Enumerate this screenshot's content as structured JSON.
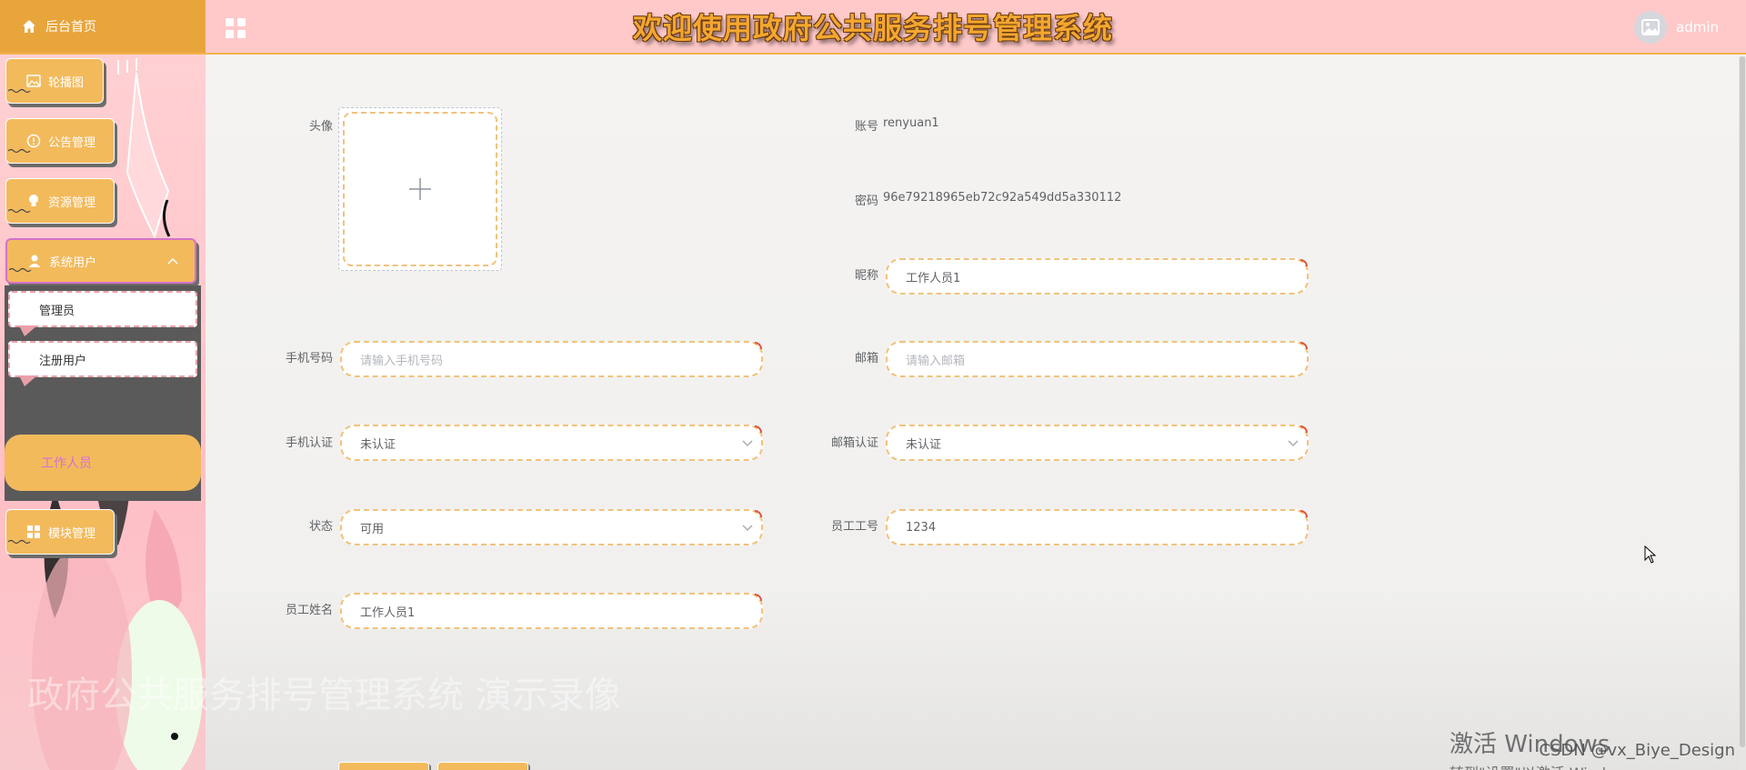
{
  "header": {
    "home_label": "后台首页",
    "title": "欢迎使用政府公共服务排号管理系统",
    "username": "admin"
  },
  "sidebar": {
    "items": [
      {
        "label": "轮播图",
        "icon": "image-icon"
      },
      {
        "label": "公告管理",
        "icon": "info-circle-icon"
      },
      {
        "label": "资源管理",
        "icon": "lightbulb-icon"
      },
      {
        "label": "系统用户",
        "icon": "user-icon"
      },
      {
        "label": "模块管理",
        "icon": "grid-icon"
      }
    ],
    "submenu": [
      "管理员",
      "注册用户",
      "工作人员"
    ],
    "active_sub": "工作人员"
  },
  "form": {
    "avatar_label": "头像",
    "account_label": "账号",
    "account_value": "renyuan1",
    "password_label": "密码",
    "password_value": "96e79218965eb72c92a549dd5a330112",
    "nickname_label": "昵称",
    "nickname_value": "工作人员1",
    "phone_label": "手机号码",
    "phone_placeholder": "请输入手机号码",
    "email_label": "邮箱",
    "email_placeholder": "请输入邮箱",
    "phone_verify_label": "手机认证",
    "phone_verify_value": "未认证",
    "email_verify_label": "邮箱认证",
    "email_verify_value": "未认证",
    "status_label": "状态",
    "status_value": "可用",
    "staff_no_label": "员工工号",
    "staff_no_value": "1234",
    "staff_name_label": "员工姓名",
    "staff_name_value": "工作人员1"
  },
  "overlay": {
    "video_watermark": "政府公共服务排号管理系统 演示录像",
    "windows_line1": "激活 Windows",
    "windows_line2": "转到\"设置\"以激活 Windows。",
    "csdn": "CSDN @vx_Biye_Design"
  },
  "colors": {
    "header_bg": "#ffc9c9",
    "menu_orange": "#f3ba5c",
    "active_text": "#d66fd9",
    "field_border": "#f1c27c"
  }
}
